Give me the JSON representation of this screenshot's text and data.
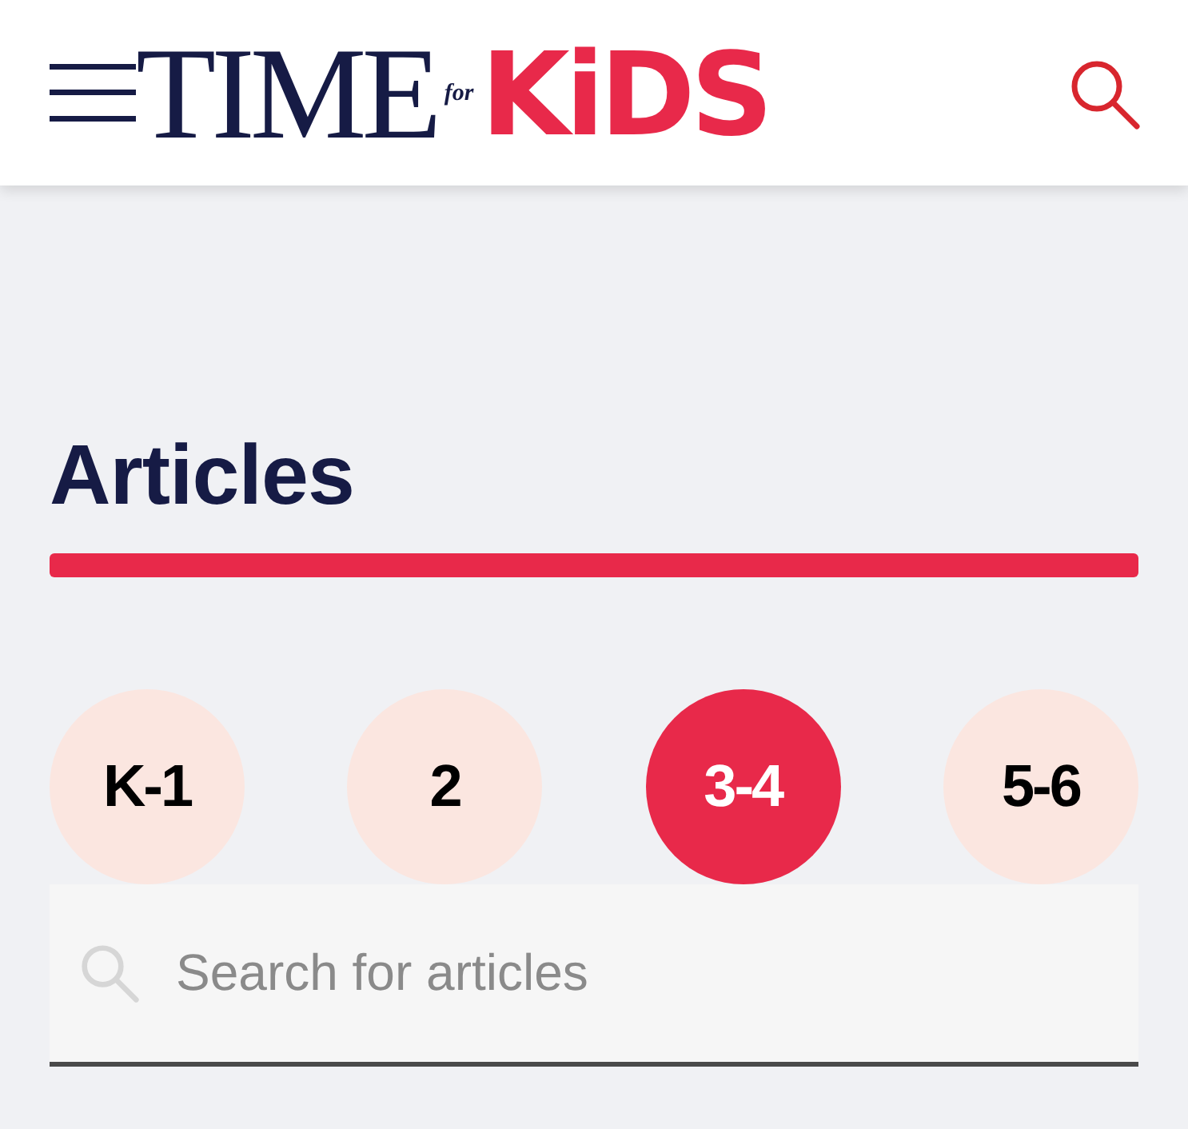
{
  "header": {
    "logo": {
      "time": "TIME",
      "for": "for",
      "kids": "KiDS"
    }
  },
  "section": {
    "title": "Articles"
  },
  "grade_tabs": [
    {
      "label": "K-1",
      "selected": false
    },
    {
      "label": "2",
      "selected": false
    },
    {
      "label": "3-4",
      "selected": true
    },
    {
      "label": "5-6",
      "selected": false
    }
  ],
  "search": {
    "placeholder": "Search for articles"
  }
}
